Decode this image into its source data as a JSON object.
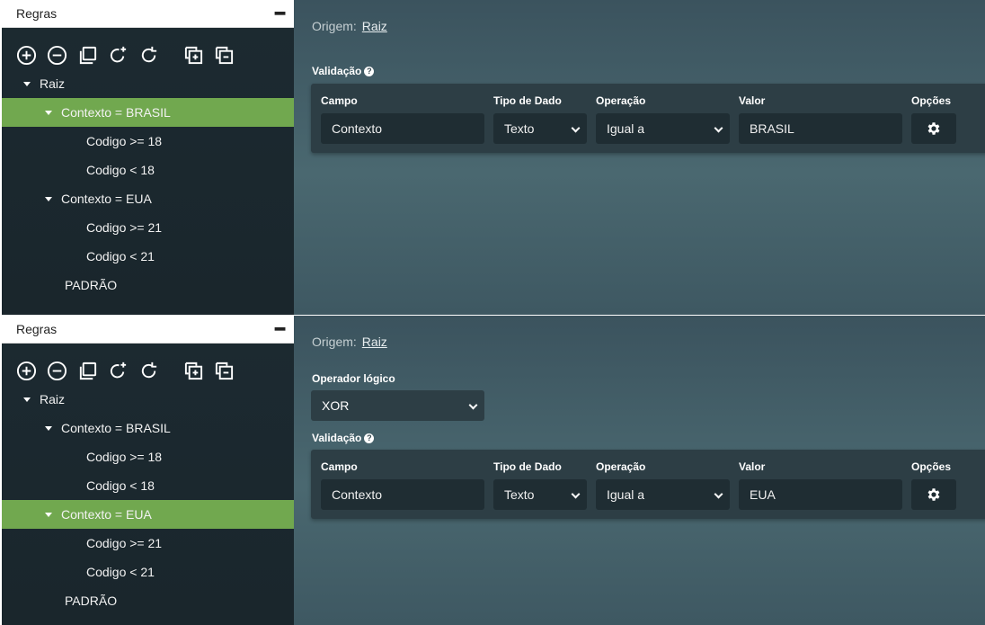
{
  "panels": [
    {
      "sidebar": {
        "title": "Regras",
        "tree": [
          {
            "label": "Raiz"
          },
          {
            "label": "Contexto = BRASIL"
          },
          {
            "label": "Codigo >= 18"
          },
          {
            "label": "Codigo < 18"
          },
          {
            "label": "Contexto = EUA"
          },
          {
            "label": "Codigo >= 21"
          },
          {
            "label": "Codigo < 21"
          },
          {
            "label": "PADRÃO"
          }
        ]
      },
      "main": {
        "origin_label": "Origem:",
        "origin_link": "Raiz",
        "validation_label": "Validação",
        "columns": {
          "campo": "Campo",
          "tipo": "Tipo de Dado",
          "operacao": "Operação",
          "valor": "Valor",
          "opcoes": "Opções"
        },
        "row": {
          "campo": "Contexto",
          "tipo": "Texto",
          "operacao": "Igual a",
          "valor": "BRASIL"
        }
      }
    },
    {
      "sidebar": {
        "title": "Regras",
        "tree": [
          {
            "label": "Raiz"
          },
          {
            "label": "Contexto = BRASIL"
          },
          {
            "label": "Codigo >= 18"
          },
          {
            "label": "Codigo < 18"
          },
          {
            "label": "Contexto = EUA"
          },
          {
            "label": "Codigo >= 21"
          },
          {
            "label": "Codigo < 21"
          },
          {
            "label": "PADRÃO"
          }
        ]
      },
      "main": {
        "origin_label": "Origem:",
        "origin_link": "Raiz",
        "logic_label": "Operador lógico",
        "logic_value": "XOR",
        "validation_label": "Validação",
        "columns": {
          "campo": "Campo",
          "tipo": "Tipo de Dado",
          "operacao": "Operação",
          "valor": "Valor",
          "opcoes": "Opções"
        },
        "row": {
          "campo": "Contexto",
          "tipo": "Texto",
          "operacao": "Igual a",
          "valor": "EUA"
        }
      }
    }
  ],
  "colors": {
    "selected_row": "#71a84f",
    "sidebar_bg": "#1c2a31",
    "panel_bg": "#2d3e45"
  },
  "icons": [
    "plus-circle-icon",
    "minus-circle-icon",
    "copy-icon",
    "rotate-add-icon",
    "refresh-icon",
    "stack-add-icon",
    "stack-remove-icon",
    "gear-icon",
    "help-icon"
  ]
}
